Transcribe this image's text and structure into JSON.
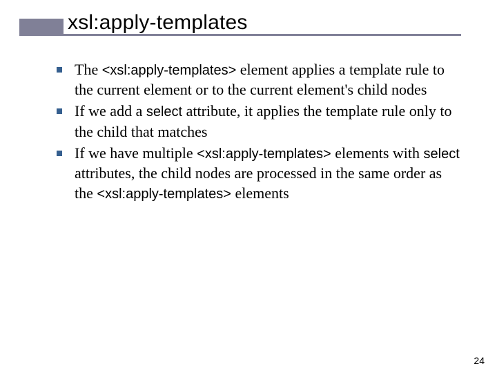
{
  "title": "xsl:apply-templates",
  "bullets": [
    {
      "pre": "The ",
      "code1": "<xsl:apply-templates>",
      "mid1": " element applies a template rule to the current element or to the current element's child nodes"
    },
    {
      "pre": "If we add a ",
      "code1": "select",
      "mid1": " attribute, it applies the template rule only to the child that matches"
    },
    {
      "pre": "If we have multiple ",
      "code1": "<xsl:apply-templates>",
      "mid1": " elements with ",
      "code2": "select",
      "mid2": " attributes, the child nodes are processed in the same order as the ",
      "code3": "<xsl:apply-templates>",
      "mid3": " elements"
    }
  ],
  "page_number": "24"
}
